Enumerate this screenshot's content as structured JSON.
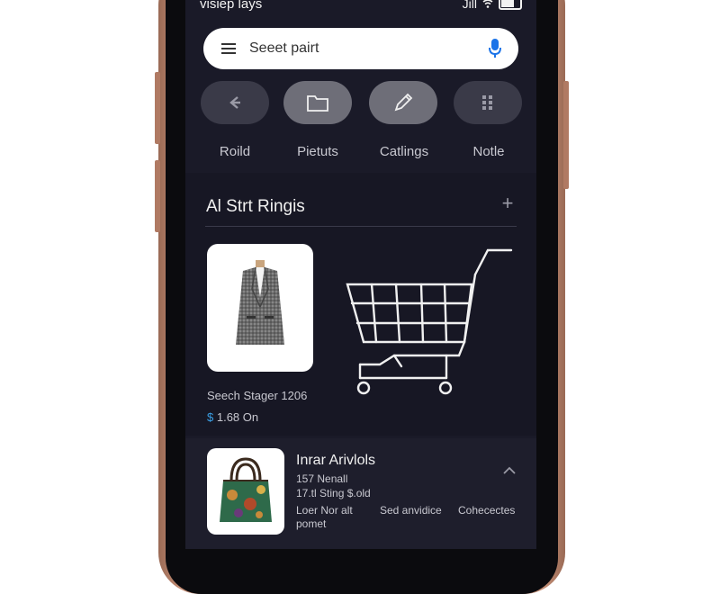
{
  "status_bar": {
    "left_text": "visiep lays",
    "carrier_text": "Jill"
  },
  "search": {
    "placeholder": "Seeet pairt",
    "icons": [
      "menu-icon",
      "mic-icon"
    ]
  },
  "quick_actions": [
    {
      "label": "Roild",
      "icon": "back-arrow-icon"
    },
    {
      "label": "Pietuts",
      "icon": "folder-icon"
    },
    {
      "label": "Catlings",
      "icon": "pencil-icon"
    },
    {
      "label": "Notle",
      "icon": "dots-grid-icon"
    }
  ],
  "section": {
    "title": "Al Strt Ringis",
    "add_icon": "plus-icon"
  },
  "featured_product": {
    "name": "Seech Stager 1206",
    "currency": "$",
    "price_text": "1.68 On",
    "image": "blazer-vest-image",
    "cart_icon": "shopping-cart-icon"
  },
  "list_item": {
    "title": "Inrar Arivlols",
    "line1": "157 Nenall",
    "line2": "17.tl Sting $.old",
    "tags": [
      "Loer Nor alt",
      "Sed anvidice",
      "Cohecectes"
    ],
    "tag_sub": "pomet",
    "image": "handbag-image",
    "expand_icon": "chevron-up-icon"
  },
  "colors": {
    "screen_bg": "#1a1a28",
    "price_accent": "#3aa0e6",
    "frame": "#c9937a"
  }
}
